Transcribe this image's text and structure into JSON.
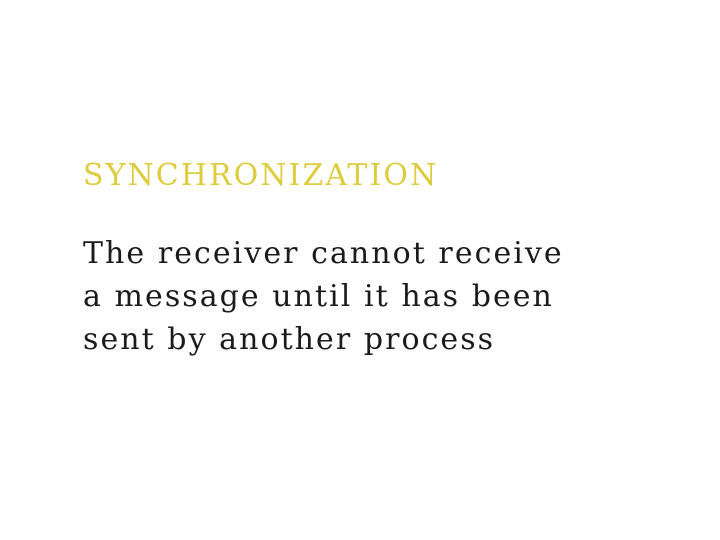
{
  "slide": {
    "background_color": "#ffffff",
    "title": {
      "text": "SYNCHRONIZATION",
      "color": "#ddcd3e"
    },
    "body": {
      "color": "#1b1b1b",
      "lines": [
        "The receiver cannot receive",
        "a message until it has been",
        "sent by another process"
      ],
      "full_text": "The receiver cannot receive a message until it has been sent by another process"
    }
  }
}
